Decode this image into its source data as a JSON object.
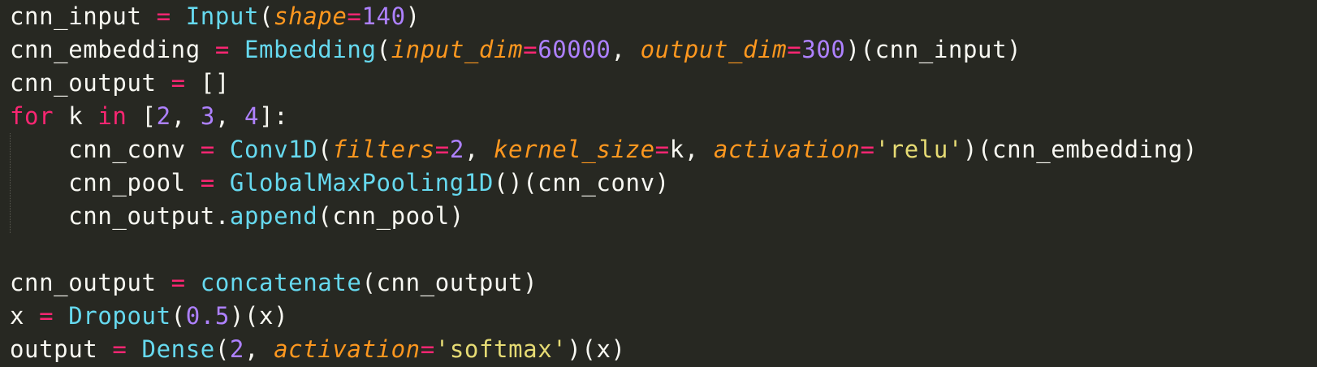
{
  "colors": {
    "background": "#272822",
    "plain": "#f8f8f2",
    "operator": "#f92672",
    "function": "#66d9ef",
    "parameter": "#fd971f",
    "number": "#ae81ff",
    "string": "#e6db74"
  },
  "lines": [
    [
      {
        "t": "cnn_input ",
        "c": "plain"
      },
      {
        "t": "=",
        "c": "op"
      },
      {
        "t": " ",
        "c": "plain"
      },
      {
        "t": "Input",
        "c": "fn"
      },
      {
        "t": "(",
        "c": "plain"
      },
      {
        "t": "shape",
        "c": "param"
      },
      {
        "t": "=",
        "c": "op"
      },
      {
        "t": "140",
        "c": "num"
      },
      {
        "t": ")",
        "c": "plain"
      }
    ],
    [
      {
        "t": "cnn_embedding ",
        "c": "plain"
      },
      {
        "t": "=",
        "c": "op"
      },
      {
        "t": " ",
        "c": "plain"
      },
      {
        "t": "Embedding",
        "c": "fn"
      },
      {
        "t": "(",
        "c": "plain"
      },
      {
        "t": "input_dim",
        "c": "param"
      },
      {
        "t": "=",
        "c": "op"
      },
      {
        "t": "60000",
        "c": "num"
      },
      {
        "t": ", ",
        "c": "plain"
      },
      {
        "t": "output_dim",
        "c": "param"
      },
      {
        "t": "=",
        "c": "op"
      },
      {
        "t": "300",
        "c": "num"
      },
      {
        "t": ")(cnn_input)",
        "c": "plain"
      }
    ],
    [
      {
        "t": "cnn_output ",
        "c": "plain"
      },
      {
        "t": "=",
        "c": "op"
      },
      {
        "t": " []",
        "c": "plain"
      }
    ],
    [
      {
        "t": "for",
        "c": "kw"
      },
      {
        "t": " k ",
        "c": "plain"
      },
      {
        "t": "in",
        "c": "kw"
      },
      {
        "t": " [",
        "c": "plain"
      },
      {
        "t": "2",
        "c": "num"
      },
      {
        "t": ", ",
        "c": "plain"
      },
      {
        "t": "3",
        "c": "num"
      },
      {
        "t": ", ",
        "c": "plain"
      },
      {
        "t": "4",
        "c": "num"
      },
      {
        "t": "]:",
        "c": "plain"
      }
    ],
    [
      {
        "t": "    cnn_conv ",
        "c": "plain"
      },
      {
        "t": "=",
        "c": "op"
      },
      {
        "t": " ",
        "c": "plain"
      },
      {
        "t": "Conv1D",
        "c": "fn"
      },
      {
        "t": "(",
        "c": "plain"
      },
      {
        "t": "filters",
        "c": "param"
      },
      {
        "t": "=",
        "c": "op"
      },
      {
        "t": "2",
        "c": "num"
      },
      {
        "t": ", ",
        "c": "plain"
      },
      {
        "t": "kernel_size",
        "c": "param"
      },
      {
        "t": "=",
        "c": "op"
      },
      {
        "t": "k, ",
        "c": "plain"
      },
      {
        "t": "activation",
        "c": "param"
      },
      {
        "t": "=",
        "c": "op"
      },
      {
        "t": "'relu'",
        "c": "str"
      },
      {
        "t": ")(cnn_embedding)",
        "c": "plain"
      }
    ],
    [
      {
        "t": "    cnn_pool ",
        "c": "plain"
      },
      {
        "t": "=",
        "c": "op"
      },
      {
        "t": " ",
        "c": "plain"
      },
      {
        "t": "GlobalMaxPooling1D",
        "c": "fn"
      },
      {
        "t": "()(cnn_conv)",
        "c": "plain"
      }
    ],
    [
      {
        "t": "    cnn_output.",
        "c": "plain"
      },
      {
        "t": "append",
        "c": "fn"
      },
      {
        "t": "(cnn_pool)",
        "c": "plain"
      }
    ],
    [],
    [
      {
        "t": "cnn_output ",
        "c": "plain"
      },
      {
        "t": "=",
        "c": "op"
      },
      {
        "t": " ",
        "c": "plain"
      },
      {
        "t": "concatenate",
        "c": "fn"
      },
      {
        "t": "(cnn_output)",
        "c": "plain"
      }
    ],
    [
      {
        "t": "x ",
        "c": "plain"
      },
      {
        "t": "=",
        "c": "op"
      },
      {
        "t": " ",
        "c": "plain"
      },
      {
        "t": "Dropout",
        "c": "fn"
      },
      {
        "t": "(",
        "c": "plain"
      },
      {
        "t": "0.5",
        "c": "num"
      },
      {
        "t": ")(x)",
        "c": "plain"
      }
    ],
    [
      {
        "t": "output ",
        "c": "plain"
      },
      {
        "t": "=",
        "c": "op"
      },
      {
        "t": " ",
        "c": "plain"
      },
      {
        "t": "Dense",
        "c": "fn"
      },
      {
        "t": "(",
        "c": "plain"
      },
      {
        "t": "2",
        "c": "num"
      },
      {
        "t": ", ",
        "c": "plain"
      },
      {
        "t": "activation",
        "c": "param"
      },
      {
        "t": "=",
        "c": "op"
      },
      {
        "t": "'softmax'",
        "c": "str"
      },
      {
        "t": ")(x)",
        "c": "plain"
      }
    ]
  ]
}
